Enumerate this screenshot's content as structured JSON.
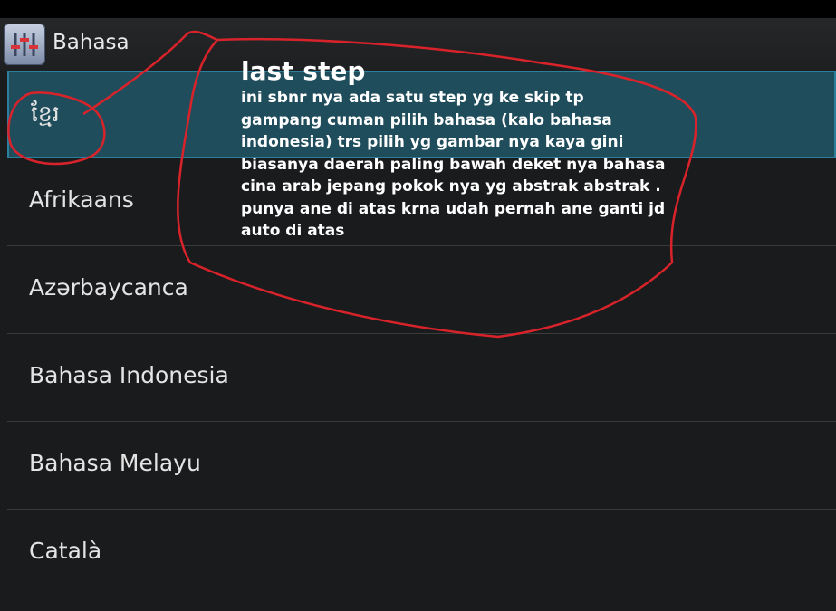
{
  "action_bar": {
    "title": "Bahasa",
    "icon": "settings-sliders-icon"
  },
  "languages": [
    {
      "label": "ខ្មែរ",
      "selected": true
    },
    {
      "label": "Afrikaans",
      "selected": false
    },
    {
      "label": "Azərbaycanca",
      "selected": false
    },
    {
      "label": "Bahasa Indonesia",
      "selected": false
    },
    {
      "label": "Bahasa Melayu",
      "selected": false
    },
    {
      "label": "Català",
      "selected": false
    }
  ],
  "annotation": {
    "title": "last step",
    "body": "ini sbnr nya ada satu step yg ke skip tp gampang cuman pilih bahasa (kalo bahasa indonesia) trs pilih yg gambar nya kaya gini biasanya daerah paling bawah deket nya bahasa cina arab jepang pokok nya yg abstrak abstrak . punya ane di atas krna udah pernah ane ganti jd auto di atas"
  },
  "colors": {
    "background": "#1a1b1d",
    "selected_fill": "#1f4d5c",
    "selected_border": "#2c7f9a",
    "marker": "#d9232a",
    "text": "#e4e4e4"
  }
}
